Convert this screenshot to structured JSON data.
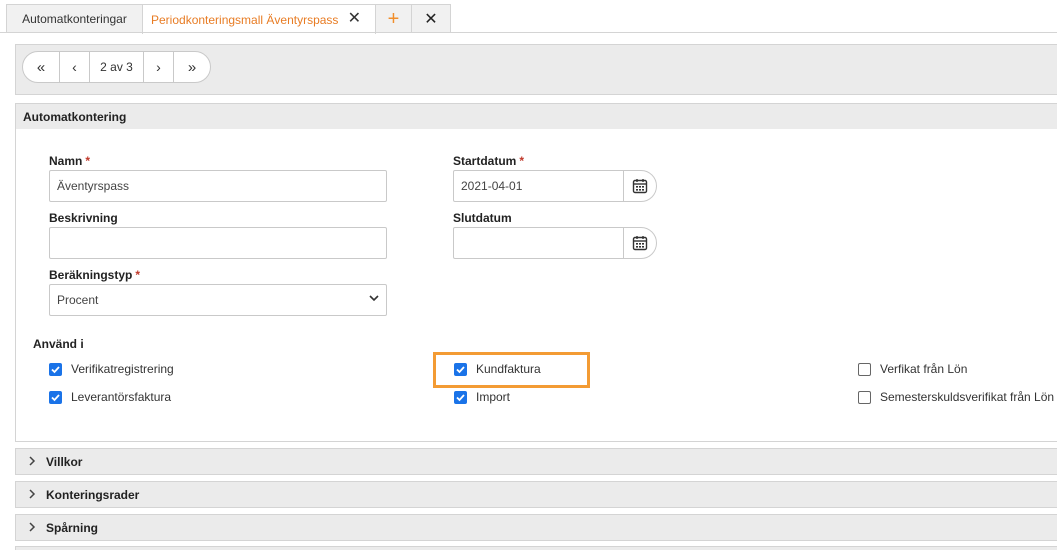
{
  "tabs": [
    {
      "label": "Automatkonteringar"
    },
    {
      "label": "Periodkonteringsmall Äventyrspass",
      "active": true
    },
    {
      "label": "+"
    },
    {
      "label": "✕"
    }
  ],
  "pager": {
    "first": "«",
    "prev": "‹",
    "info": "2 av 3",
    "next": "›",
    "last": "»"
  },
  "section_main": {
    "title": "Automatkontering"
  },
  "form": {
    "namn_label": "Namn",
    "namn_value": "Äventyrspass",
    "beskrivning_label": "Beskrivning",
    "beskrivning_value": "",
    "berakningstyp_label": "Beräkningstyp",
    "berakningstyp_value": "Procent",
    "startdatum_label": "Startdatum",
    "startdatum_value": "2021-04-01",
    "slutdatum_label": "Slutdatum",
    "slutdatum_value": "",
    "required_mark": "*"
  },
  "anvand_i": {
    "label": "Använd i",
    "options": [
      {
        "label": "Verifikatregistrering",
        "checked": true
      },
      {
        "label": "Leverantörsfaktura",
        "checked": true
      },
      {
        "label": "Kundfaktura",
        "checked": true
      },
      {
        "label": "Import",
        "checked": true
      },
      {
        "label": "Verfikat från Lön",
        "checked": false
      },
      {
        "label": "Semesterskuldsverifikat från Lön",
        "checked": false
      }
    ]
  },
  "sections": [
    {
      "title": "Villkor"
    },
    {
      "title": "Konteringsrader"
    },
    {
      "title": "Spårning"
    }
  ],
  "colors": {
    "accent": "#e87c24",
    "highlight": "#f39b34",
    "checkbox": "#1a73e8",
    "required": "#c0392b"
  }
}
